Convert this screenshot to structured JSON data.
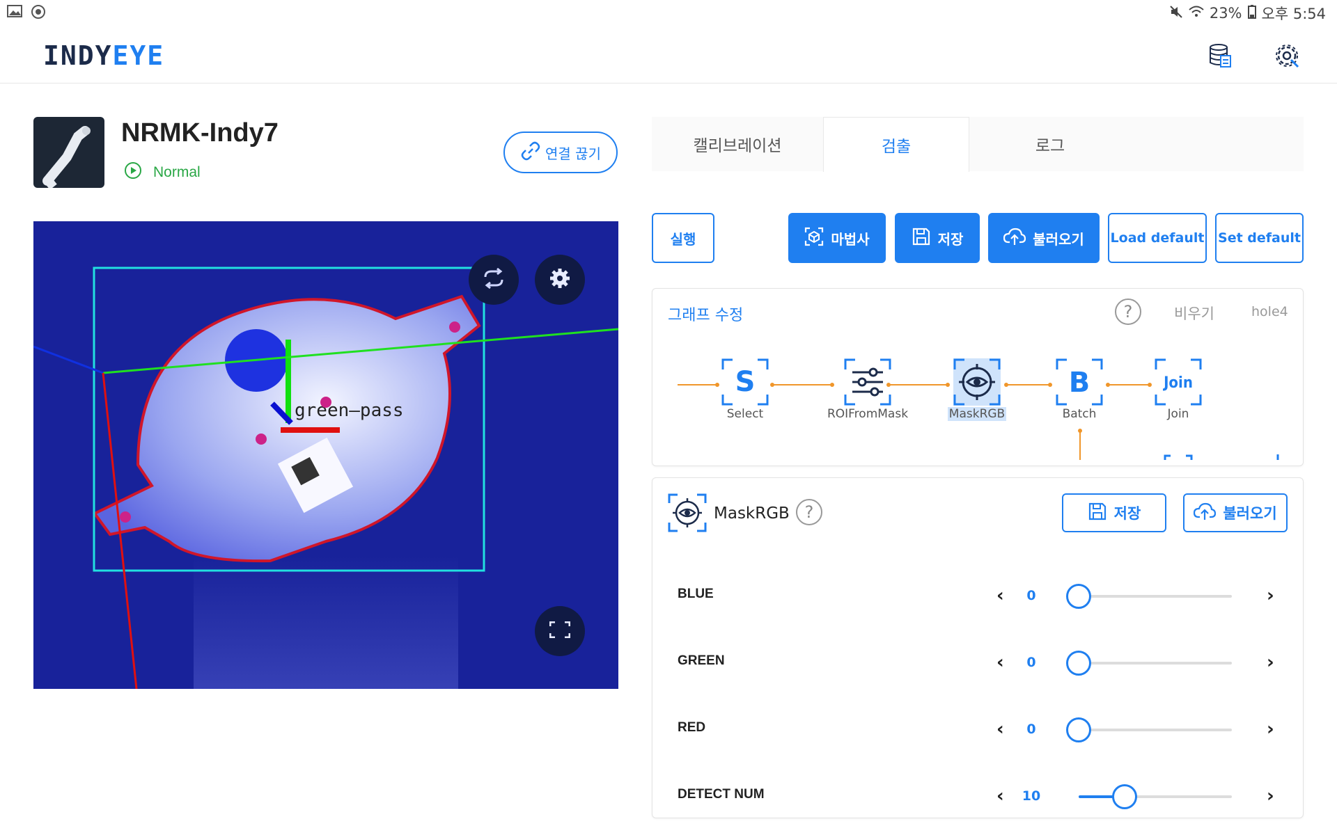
{
  "status_bar": {
    "battery": "23%",
    "time": "오후 5:54"
  },
  "app": {
    "logo_part1": "INDY",
    "logo_part2": "EYE",
    "header_icons": [
      "database-icon",
      "settings-gear-icon"
    ]
  },
  "device": {
    "name": "NRMK-Indy7",
    "status": "Normal",
    "disconnect_label": "연결 끊기"
  },
  "camera": {
    "overlay_text": "green—pass",
    "buttons": [
      "refresh-icon",
      "gear-icon",
      "fullscreen-icon"
    ]
  },
  "tabs": [
    {
      "label": "캘리브레이션",
      "active": false
    },
    {
      "label": "검출",
      "active": true
    },
    {
      "label": "로그",
      "active": false
    }
  ],
  "toolbar": {
    "run": "실행",
    "wizard": "마법사",
    "save": "저장",
    "load": "불러오기",
    "load_default": "Load default",
    "set_default": "Set default"
  },
  "graph": {
    "title": "그래프 수정",
    "help": "?",
    "clear": "비우기",
    "name": "hole4",
    "nodes": [
      {
        "label": "Select",
        "glyph": "S",
        "icon": "select-icon"
      },
      {
        "label": "ROIFromMask",
        "glyph": "",
        "icon": "sliders-icon"
      },
      {
        "label": "MaskRGB",
        "glyph": "",
        "icon": "eye-target-icon",
        "selected": true
      },
      {
        "label": "Batch",
        "glyph": "B",
        "icon": "batch-icon"
      },
      {
        "label": "Join",
        "glyph": "Join",
        "icon": "join-icon"
      }
    ]
  },
  "mask_panel": {
    "title": "MaskRGB",
    "help": "?",
    "save": "저장",
    "load": "불러오기",
    "params": [
      {
        "label": "BLUE",
        "value": "0",
        "fraction": 0.0
      },
      {
        "label": "GREEN",
        "value": "0",
        "fraction": 0.0
      },
      {
        "label": "RED",
        "value": "0",
        "fraction": 0.0
      },
      {
        "label": "DETECT NUM",
        "value": "10",
        "fraction": 0.3
      }
    ]
  },
  "colors": {
    "accent": "#1f7ff0",
    "status_ok": "#29a745",
    "camera_bg": "#18229a"
  }
}
